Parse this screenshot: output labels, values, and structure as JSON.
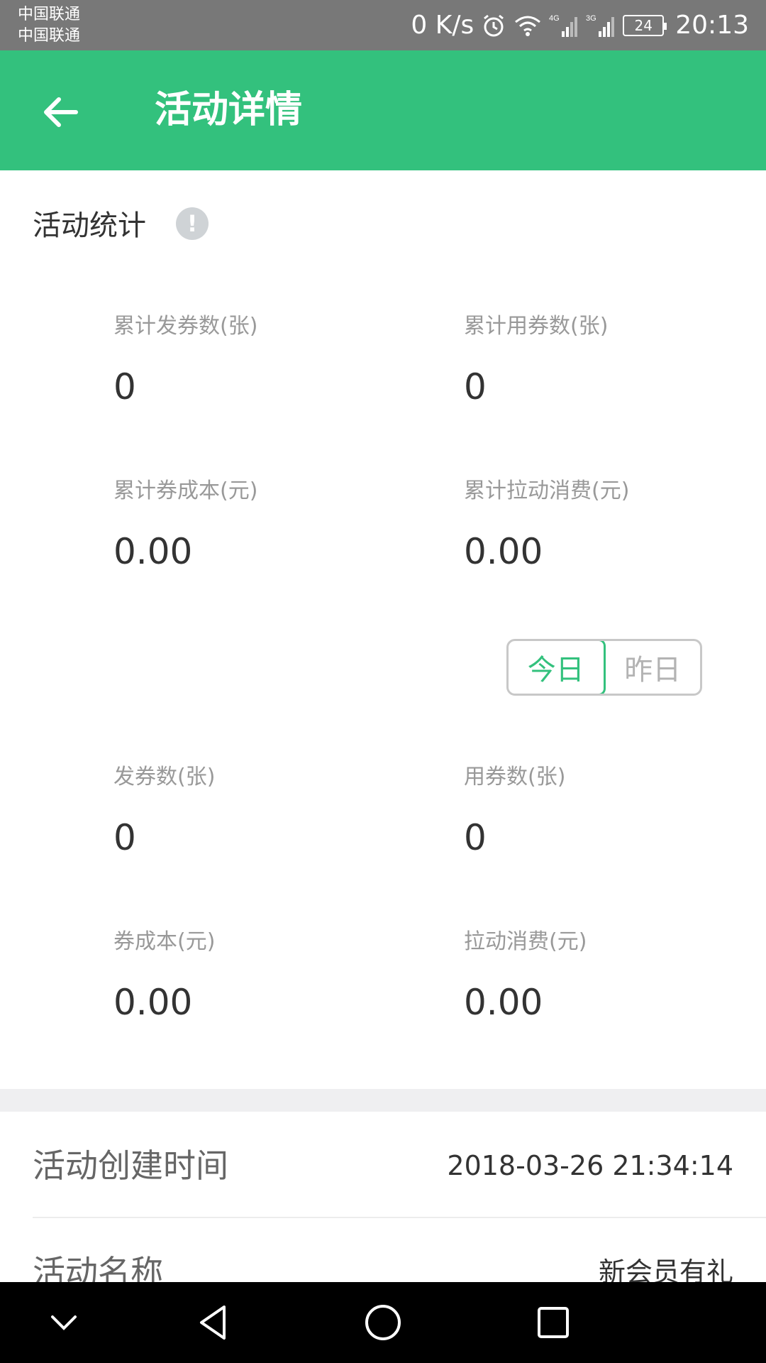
{
  "status_bar": {
    "carrier_1": "中国联通",
    "carrier_2": "中国联通",
    "net_speed": "0 K/s",
    "net_4g": "4G",
    "net_3g": "3G",
    "battery_level": "24",
    "time": "20:13"
  },
  "app_bar": {
    "title": "活动详情",
    "back_icon": "arrow-left-icon"
  },
  "stats": {
    "title": "活动统计",
    "info_glyph": "!",
    "cumulative": [
      {
        "label": "累计发券数(张)",
        "value": "0"
      },
      {
        "label": "累计用券数(张)",
        "value": "0"
      },
      {
        "label": "累计券成本(元)",
        "value": "0.00"
      },
      {
        "label": "累计拉动消费(元)",
        "value": "0.00"
      }
    ],
    "toggle": {
      "today": "今日",
      "yesterday": "昨日",
      "selected": "today"
    },
    "daily": [
      {
        "label": "发券数(张)",
        "value": "0"
      },
      {
        "label": "用券数(张)",
        "value": "0"
      },
      {
        "label": "券成本(元)",
        "value": "0.00"
      },
      {
        "label": "拉动消费(元)",
        "value": "0.00"
      }
    ]
  },
  "details": [
    {
      "label": "活动创建时间",
      "value": "2018-03-26 21:34:14"
    },
    {
      "label": "活动名称",
      "value": "新会员有礼"
    }
  ],
  "colors": {
    "accent": "#33c17d",
    "status_bar": "#787878",
    "nav_bar": "#000000"
  },
  "nav_bar": {
    "icons": [
      "chevron-down-icon",
      "back-triangle-icon",
      "home-circle-icon",
      "recents-square-icon"
    ]
  }
}
